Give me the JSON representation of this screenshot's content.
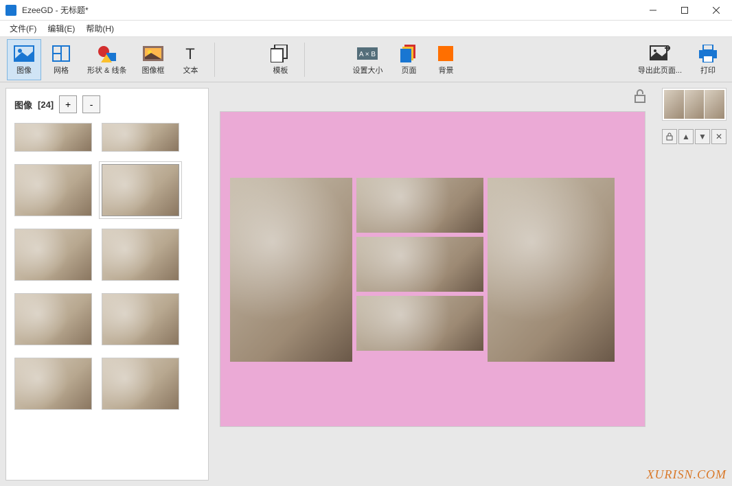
{
  "window": {
    "title": "EzeeGD - 无标题*"
  },
  "menubar": {
    "file": "文件(F)",
    "edit": "编辑(E)",
    "help": "帮助(H)"
  },
  "toolbar": {
    "image": "图像",
    "grid": "网格",
    "shapes": "形状 & 线条",
    "frame": "图像框",
    "text": "文本",
    "template": "模板",
    "setsize": "设置大小",
    "page": "页面",
    "background": "背景",
    "export": "导出此页面...",
    "print": "打印"
  },
  "sidebar": {
    "label": "图像",
    "count": "[24]",
    "add": "+",
    "remove": "-"
  },
  "rightpanel": {
    "lock": "🔓",
    "up": "▲",
    "down": "▼",
    "delete": "✕"
  },
  "watermark": "XURISN.COM"
}
